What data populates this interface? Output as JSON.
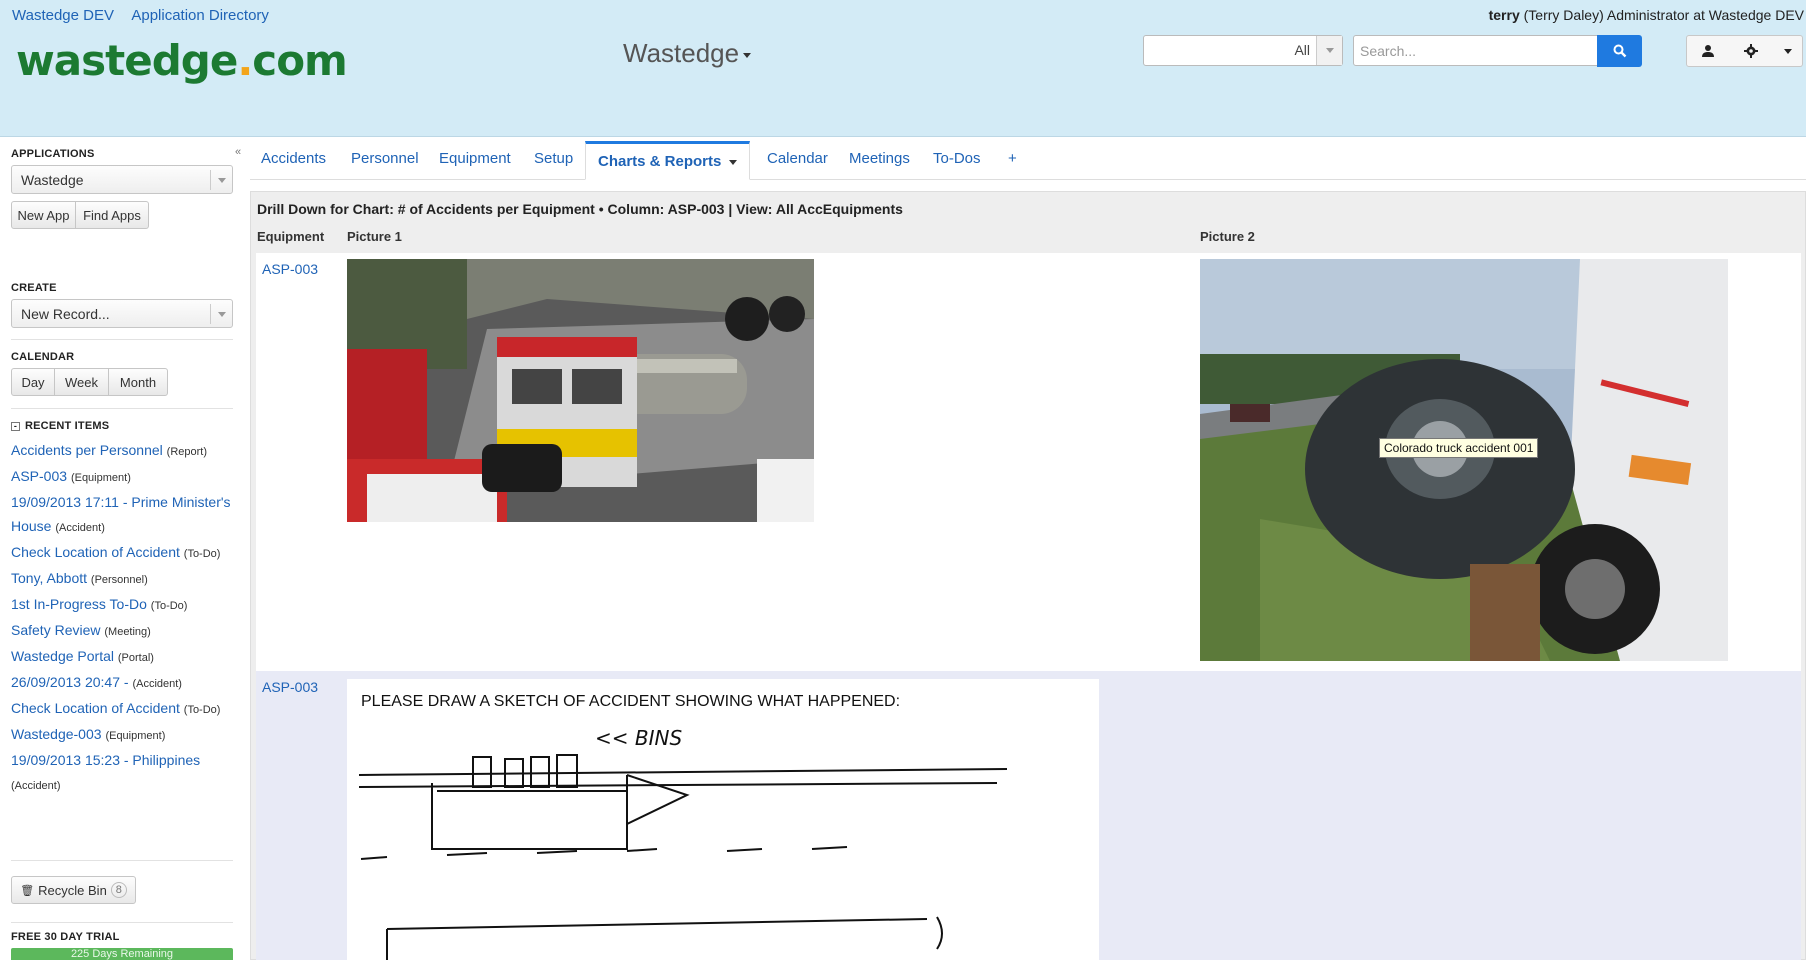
{
  "header": {
    "links": [
      "Wastedge DEV",
      "Application Directory"
    ],
    "user": {
      "name": "terry",
      "detail": "(Terry Daley) Administrator at Wastedge DEV"
    },
    "logo_text": "wastedge.com",
    "app_title": "Wastedge",
    "scope_value": "All",
    "search_placeholder": "Search...",
    "icons": [
      "search-icon",
      "user-icon",
      "gear-icon",
      "chevron-down-icon"
    ]
  },
  "sidebar": {
    "applications_label": "APPLICATIONS",
    "application_value": "Wastedge",
    "new_app": "New App",
    "find_apps": "Find Apps",
    "create_label": "CREATE",
    "create_value": "New Record...",
    "calendar_label": "CALENDAR",
    "calendar_buttons": [
      "Day",
      "Week",
      "Month"
    ],
    "recent_label": "RECENT ITEMS",
    "recent_items": [
      {
        "label": "Accidents per Personnel",
        "type": "(Report)"
      },
      {
        "label": "ASP-003",
        "type": "(Equipment)"
      },
      {
        "label": "19/09/2013 17:11 - Prime Minister's House",
        "type": "(Accident)"
      },
      {
        "label": "Check Location of Accident",
        "type": "(To-Do)"
      },
      {
        "label": "Tony, Abbott",
        "type": "(Personnel)"
      },
      {
        "label": "1st In-Progress To-Do",
        "type": "(To-Do)"
      },
      {
        "label": "Safety Review",
        "type": "(Meeting)"
      },
      {
        "label": "Wastedge Portal",
        "type": "(Portal)"
      },
      {
        "label": "26/09/2013 20:47 -",
        "type": "(Accident)"
      },
      {
        "label": "Check Location of Accident",
        "type": "(To-Do)"
      },
      {
        "label": "Wastedge-003",
        "type": "(Equipment)"
      },
      {
        "label": "19/09/2013 15:23 - Philippines",
        "type": "(Accident)"
      }
    ],
    "recycle_bin": "Recycle Bin",
    "recycle_count": "8",
    "trial_label": "FREE 30 DAY TRIAL",
    "trial_bar": "225 Days Remaining"
  },
  "tabs": [
    {
      "label": "Accidents"
    },
    {
      "label": "Personnel"
    },
    {
      "label": "Equipment"
    },
    {
      "label": "Setup"
    },
    {
      "label": "Charts & Reports",
      "active": true
    },
    {
      "label": "Calendar"
    },
    {
      "label": "Meetings"
    },
    {
      "label": "To-Dos"
    },
    {
      "label": "+"
    }
  ],
  "report": {
    "title": "Drill Down for Chart: # of Accidents per Equipment • Column: ASP-003  | View: All AccEquipments",
    "columns": [
      "Equipment",
      "Picture 1",
      "Picture 2"
    ],
    "rows": [
      {
        "equipment": "ASP-003",
        "picture2_tooltip": "Colorado truck accident 001"
      },
      {
        "equipment": "ASP-003",
        "sketch_heading": "PLEASE DRAW A SKETCH OF ACCIDENT SHOWING WHAT HAPPENED:",
        "sketch_note": "<< BINS"
      }
    ]
  }
}
